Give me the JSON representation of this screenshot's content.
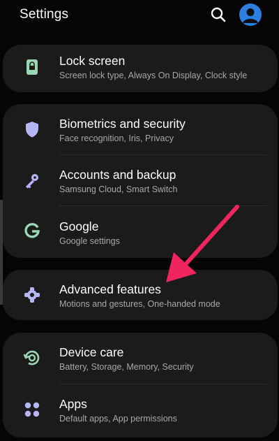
{
  "header": {
    "title": "Settings",
    "search_icon": "search-icon",
    "avatar_icon": "account-avatar-icon"
  },
  "colors": {
    "background": "#050505",
    "card": "#1b1b1b",
    "primary_text": "#ffffff",
    "secondary_text": "#a8a8a8",
    "accent_blue": "#2b7fe0",
    "icon_lavender": "#b6b6f5",
    "icon_mint": "#9ad7b4",
    "annotation_arrow": "#f0245f"
  },
  "items": [
    {
      "label": "Lock screen",
      "subtitle": "Screen lock type, Always On Display, Clock style",
      "icon": "lock-icon"
    },
    {
      "label": "Biometrics and security",
      "subtitle": "Face recognition, Iris, Privacy",
      "icon": "shield-icon"
    },
    {
      "label": "Accounts and backup",
      "subtitle": "Samsung Cloud, Smart Switch",
      "icon": "key-icon"
    },
    {
      "label": "Google",
      "subtitle": "Google settings",
      "icon": "google-icon"
    },
    {
      "label": "Advanced features",
      "subtitle": "Motions and gestures, One-handed mode",
      "icon": "puzzle-gear-icon"
    },
    {
      "label": "Device care",
      "subtitle": "Battery, Storage, Memory, Security",
      "icon": "device-care-icon"
    },
    {
      "label": "Apps",
      "subtitle": "Default apps, App permissions",
      "icon": "apps-grid-icon"
    }
  ]
}
